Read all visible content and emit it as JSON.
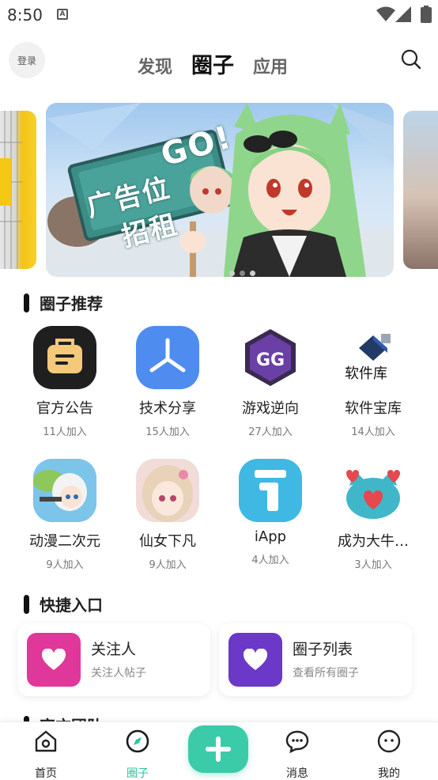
{
  "status_bar": {
    "time": "8:50",
    "notification_icon": "a-letter-icon"
  },
  "header": {
    "login_label": "登录",
    "tabs": [
      {
        "label": "发现",
        "active": false
      },
      {
        "label": "圈子",
        "active": true
      },
      {
        "label": "应用",
        "active": false
      }
    ]
  },
  "banner": {
    "sign_line1": "广告位",
    "sign_line2": "招租",
    "sign_corner": "GO!",
    "page_count": 3,
    "active_page": 2
  },
  "recommend": {
    "title": "圈子推荐",
    "items": [
      {
        "name": "官方公告",
        "members": "11人加入",
        "icon": "announcement-icon",
        "color": "#1f1f1f"
      },
      {
        "name": "技术分享",
        "members": "15人加入",
        "icon": "share-icon",
        "color": "#4e8cf0"
      },
      {
        "name": "游戏逆向",
        "members": "27人加入",
        "icon": "gg-icon",
        "color": "#ffffff"
      },
      {
        "name": "软件宝库",
        "members": "14人加入",
        "icon": "software-library-icon",
        "color": "#ffffff",
        "icon_text": "软件库"
      },
      {
        "name": "动漫二次元",
        "members": "9人加入",
        "icon": "anime-avatar-icon",
        "color": "#8fd0f0"
      },
      {
        "name": "仙女下凡",
        "members": "9人加入",
        "icon": "fairy-avatar-icon",
        "color": "#f3d7d7"
      },
      {
        "name": "iApp",
        "members": "4人加入",
        "icon": "iapp-icon",
        "color": "#3fb8e4"
      },
      {
        "name": "成为大牛…",
        "members": "3人加入",
        "icon": "cat-hearts-icon",
        "color": "#ffffff"
      }
    ]
  },
  "quick": {
    "title": "快捷入口",
    "cards": [
      {
        "title": "关注人",
        "subtitle": "关注人帖子",
        "icon": "heart-icon",
        "color": "#e0379a"
      },
      {
        "title": "圈子列表",
        "subtitle": "查看所有圈子",
        "icon": "heart-icon",
        "color": "#6b38c7"
      }
    ]
  },
  "next_section_partial": "官方团队",
  "bottom_nav": {
    "items": [
      {
        "label": "首页",
        "icon": "home-icon",
        "active": false
      },
      {
        "label": "圈子",
        "icon": "compass-icon",
        "active": true
      },
      {
        "label": "消息",
        "icon": "chat-icon",
        "active": false
      },
      {
        "label": "我的",
        "icon": "profile-icon",
        "active": false
      }
    ],
    "fab_icon": "plus-icon",
    "accent": "#3ccba8"
  }
}
